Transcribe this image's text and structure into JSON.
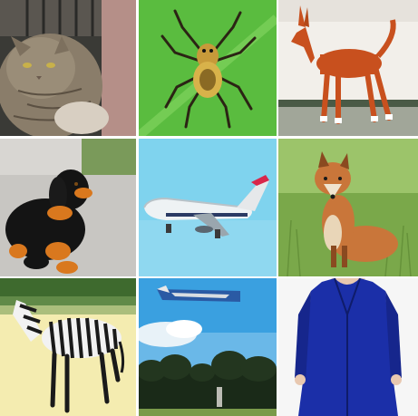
{
  "grid": {
    "rows": 3,
    "columns": 3,
    "tiles": [
      {
        "subject": "cat-photo"
      },
      {
        "subject": "spider-photo"
      },
      {
        "subject": "dog-photo"
      },
      {
        "subject": "puppy-photo"
      },
      {
        "subject": "airplane-photo"
      },
      {
        "subject": "fox-photo"
      },
      {
        "subject": "zebra-photo"
      },
      {
        "subject": "airplane-over-trees-photo"
      },
      {
        "subject": "blue-coat-photo"
      }
    ]
  },
  "colors": {
    "cat_fur": "#8a7d6a",
    "spider_bg": "#4fb33a",
    "dog_coat": "#c8501e",
    "puppy_black": "#141414",
    "puppy_tan": "#d9781e",
    "sky_blue": "#7fd3ee",
    "fox_orange": "#c9763a",
    "grass_green": "#7aa84a",
    "coat_blue": "#1b2fa8"
  }
}
